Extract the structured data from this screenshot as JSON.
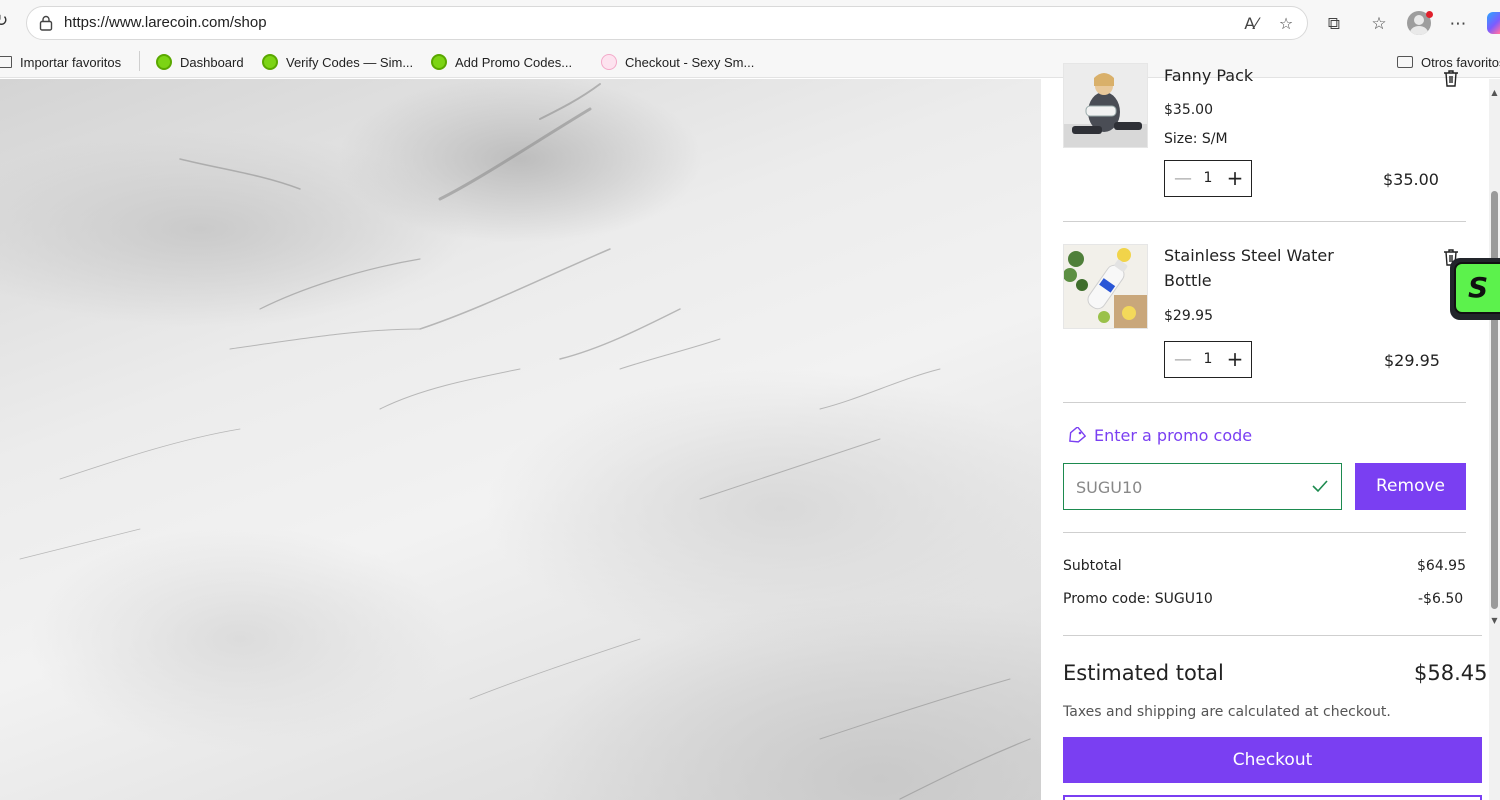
{
  "browser": {
    "url": "https://www.larecoin.com/shop",
    "bookmarks": [
      {
        "label": "Importar favoritos",
        "icon": "import-icon"
      },
      {
        "label": "Dashboard",
        "icon": "green-badge-icon"
      },
      {
        "label": "Verify Codes — Sim...",
        "icon": "green-badge-icon"
      },
      {
        "label": "Add Promo Codes...",
        "icon": "green-badge-icon"
      },
      {
        "label": "Checkout - Sexy Sm...",
        "icon": "pink-logo-icon"
      }
    ],
    "other_favorites": "Otros favoritos"
  },
  "cart": {
    "items": [
      {
        "name": "Fanny Pack",
        "price": "$35.00",
        "size": "Size: S/M",
        "quantity": "1",
        "line_total": "$35.00"
      },
      {
        "name_line1": "Stainless Steel Water",
        "name_line2": "Bottle",
        "price": "$29.95",
        "quantity": "1",
        "line_total": "$29.95"
      }
    ],
    "promo": {
      "link_label": "Enter a promo code",
      "value": "SUGU10",
      "remove_label": "Remove"
    },
    "summary": {
      "subtotal_label": "Subtotal",
      "subtotal_value": "$64.95",
      "promo_label": "Promo code: SUGU10",
      "promo_value": "-$6.50",
      "total_label": "Estimated total",
      "total_value": "$58.45",
      "note": "Taxes and shipping are calculated at checkout."
    },
    "checkout_label": "Checkout"
  },
  "widget": {
    "letter": "S"
  },
  "colors": {
    "accent": "#7a3ff2",
    "promo_border": "#1d8a4f"
  }
}
